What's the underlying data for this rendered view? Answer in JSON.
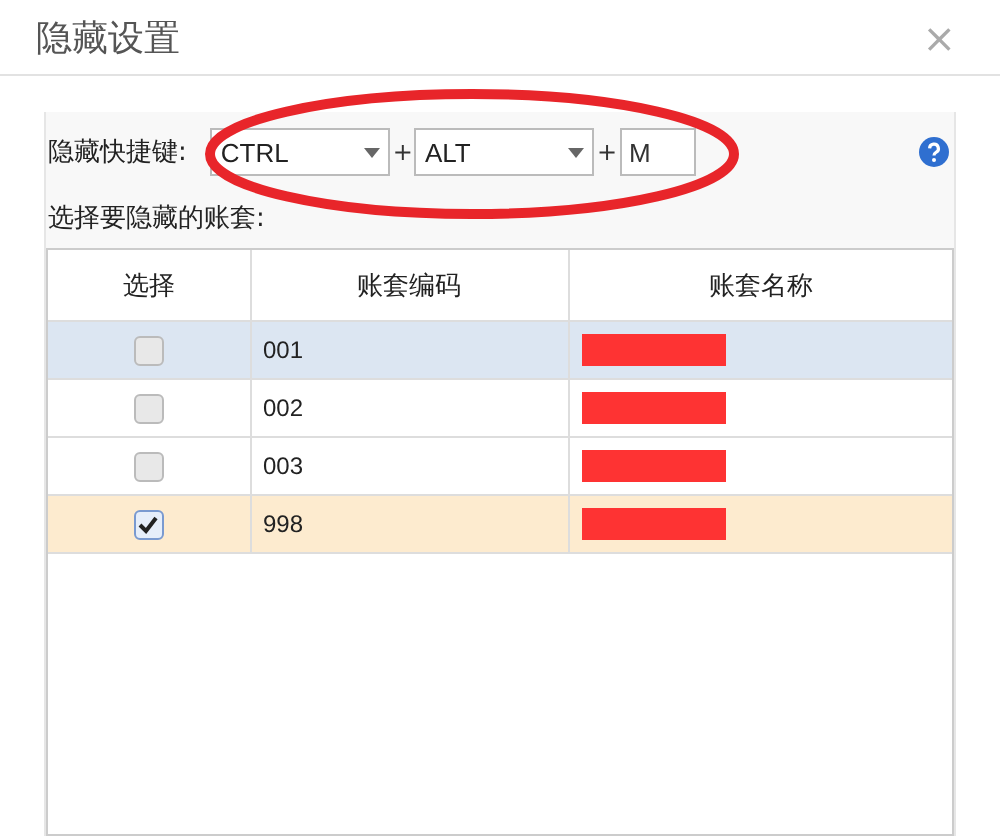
{
  "window": {
    "title": "隐藏设置",
    "close": "×"
  },
  "shortcut": {
    "label": "隐藏快捷键:",
    "keys": [
      {
        "kind": "select",
        "value": "CTRL"
      },
      {
        "kind": "plus",
        "value": "+"
      },
      {
        "kind": "select",
        "value": "ALT"
      },
      {
        "kind": "plus",
        "value": "+"
      },
      {
        "kind": "input",
        "value": "M"
      }
    ],
    "highlighted": true
  },
  "accounts_label": "选择要隐藏的账套:",
  "table": {
    "columns": [
      "选择",
      "账套编码",
      "账套名称"
    ],
    "rows": [
      {
        "checked": false,
        "selected": false,
        "hovered": true,
        "code": "001",
        "name_redacted": true
      },
      {
        "checked": false,
        "selected": false,
        "hovered": false,
        "code": "002",
        "name_redacted": true
      },
      {
        "checked": false,
        "selected": false,
        "hovered": false,
        "code": "003",
        "name_redacted": true
      },
      {
        "checked": true,
        "selected": true,
        "hovered": false,
        "code": "998",
        "name_redacted": true
      }
    ]
  }
}
